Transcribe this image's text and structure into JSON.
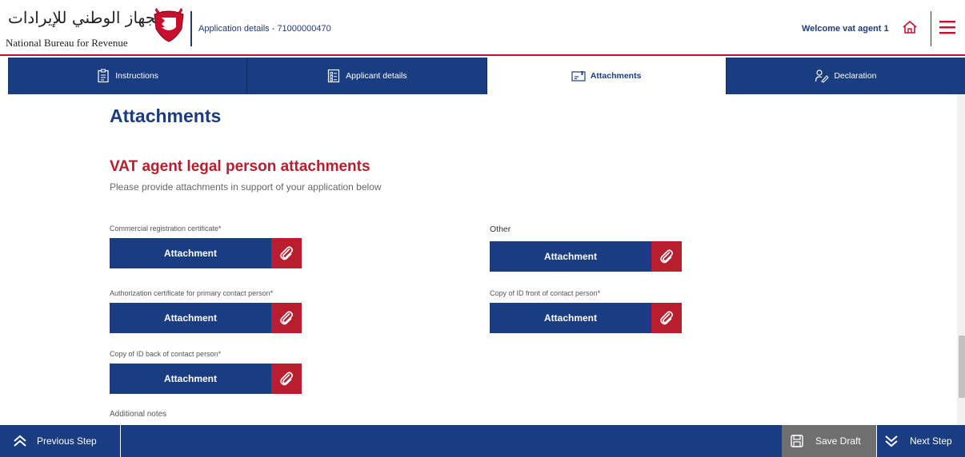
{
  "header": {
    "logo_ar": "الجهاز الوطني للإيرادات",
    "logo_en": "National Bureau for Revenue",
    "app_details": "Application details - 71000000470",
    "welcome": "Welcome vat agent 1"
  },
  "tabs": [
    {
      "label": "Instructions",
      "icon": "clipboard-icon"
    },
    {
      "label": "Applicant details",
      "icon": "checklist-icon"
    },
    {
      "label": "Attachments",
      "icon": "attachment-card-icon",
      "active": true
    },
    {
      "label": "Declaration",
      "icon": "signature-icon"
    }
  ],
  "main": {
    "title": "Attachments",
    "section_title": "VAT agent legal person attachments",
    "section_subtitle": "Please provide attachments in support of your application below",
    "fields": [
      {
        "label": "Commercial registration certificate*",
        "button": "Attachment"
      },
      {
        "label": "Authorization certificate for primary contact person*",
        "button": "Attachment"
      },
      {
        "label": "Copy of ID back of contact person*",
        "button": "Attachment"
      },
      {
        "label": "Other",
        "button": "Attachment"
      },
      {
        "label": "Copy of ID front of contact person*",
        "button": "Attachment"
      }
    ],
    "notes_label": "Additional notes"
  },
  "footer": {
    "prev": "Previous Step",
    "save": "Save Draft",
    "next": "Next Step"
  },
  "colors": {
    "navy": "#1a3c80",
    "red": "#b81e2d",
    "gray": "#6f6f6f"
  }
}
